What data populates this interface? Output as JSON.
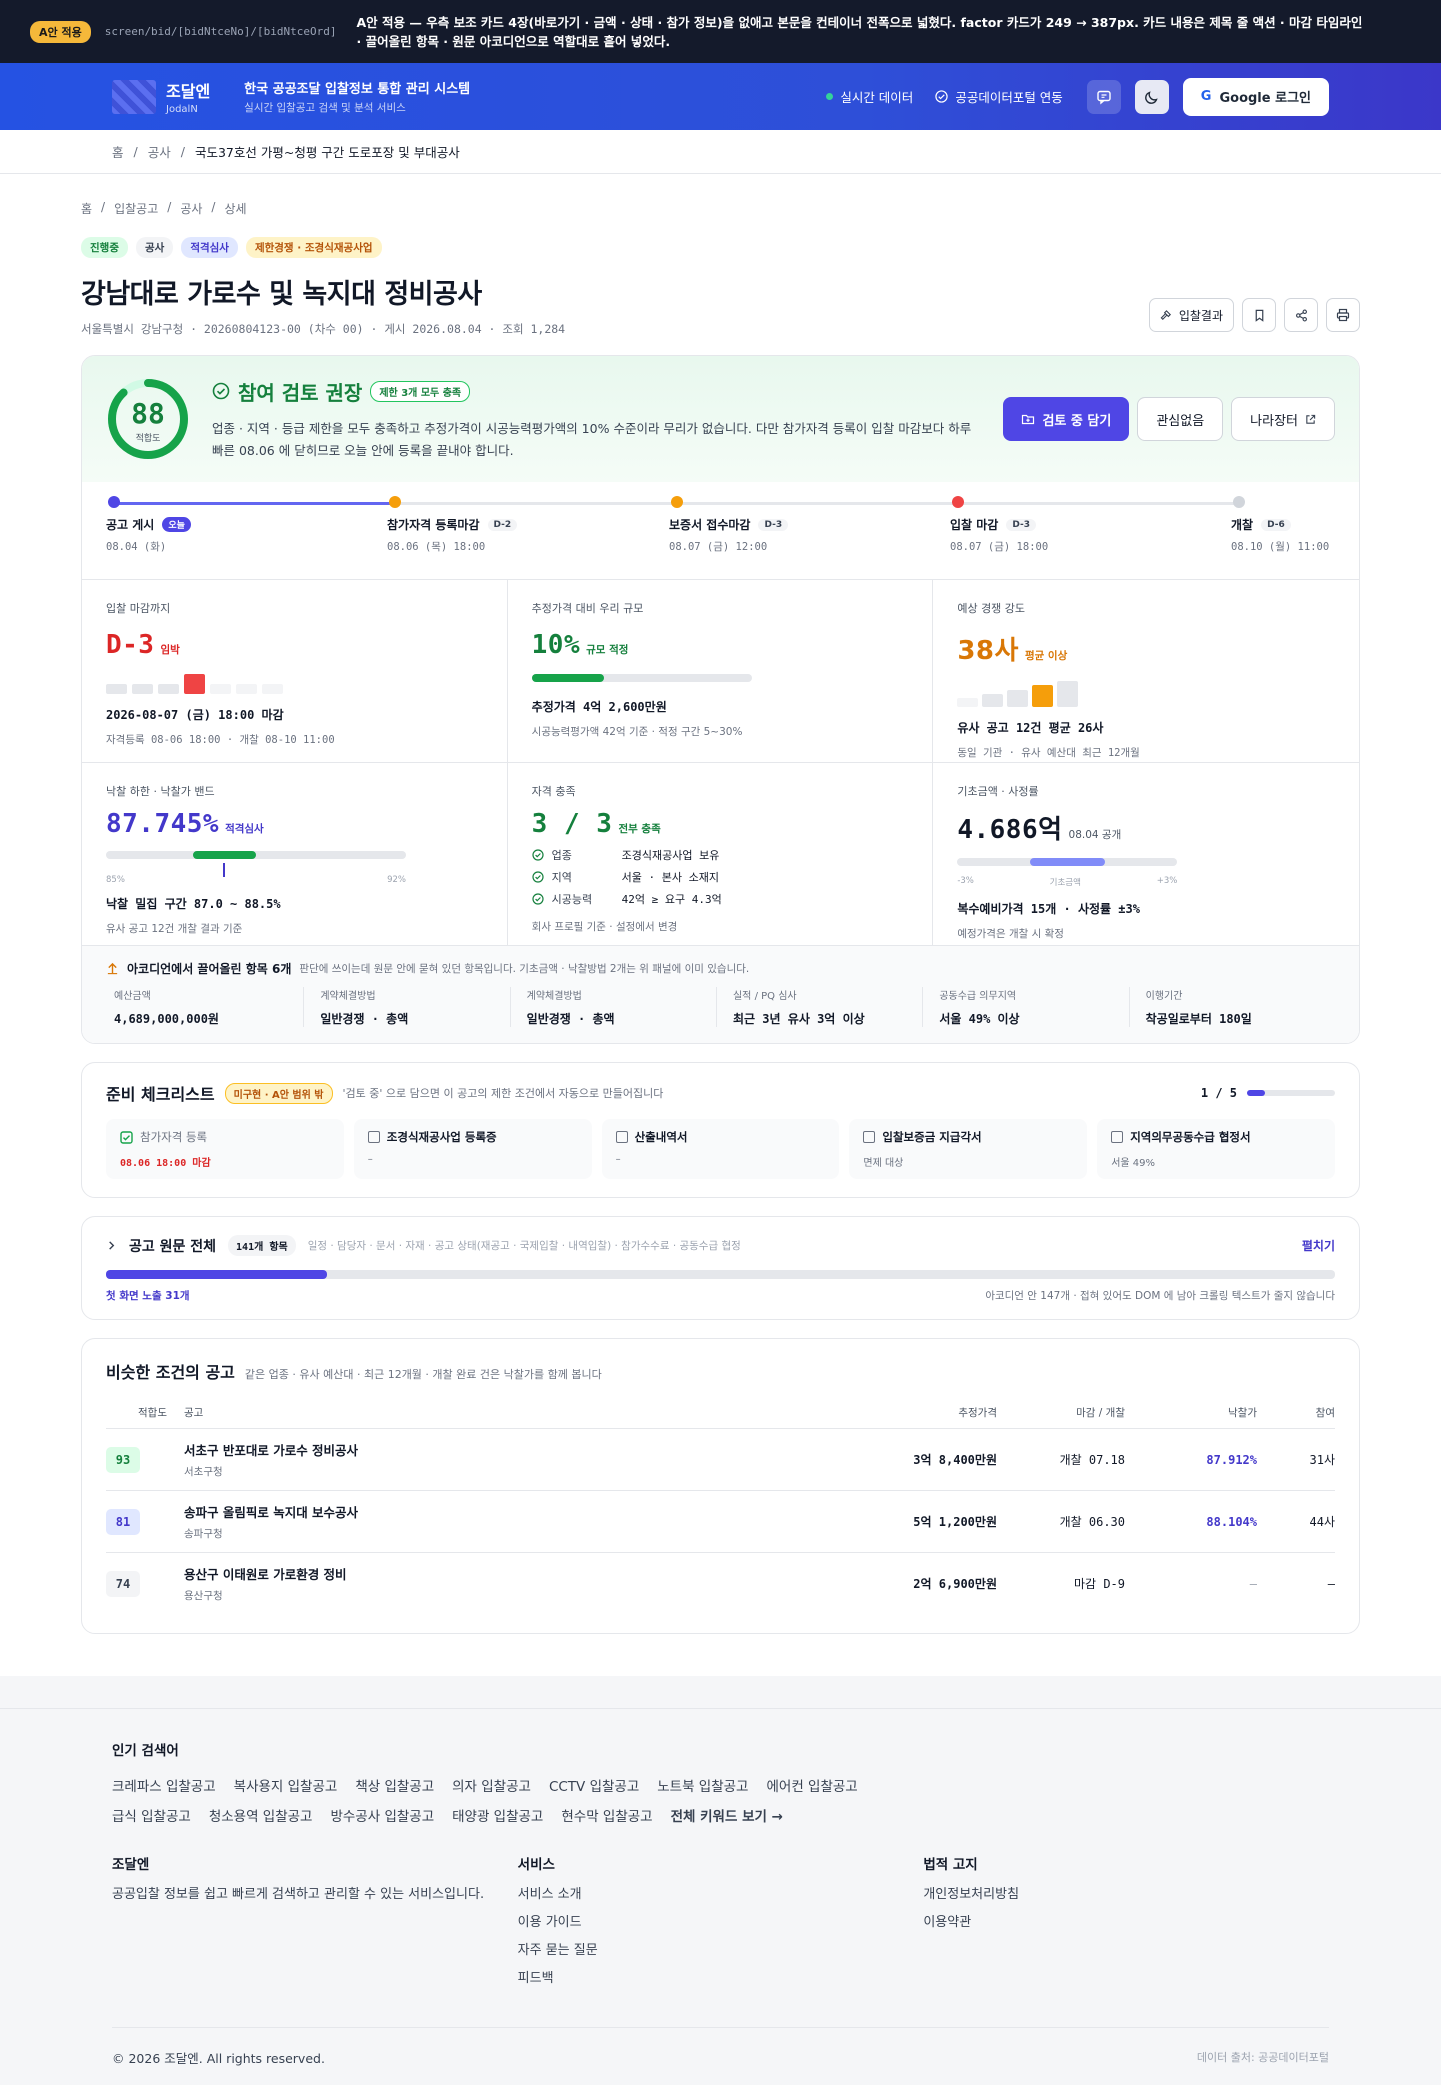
{
  "banner": {
    "pill": "A안 적용",
    "route": "screen/bid/[bidNtceNo]/[bidNtceOrd]",
    "note": "A안 적용 — 우측 보조 카드 4장(바로가기 · 금액 · 상태 · 참가 정보)을 없애고 본문을 컨테이너 전폭으로 넓혔다. factor 카드가 249 → 387px. 카드 내용은 제목 줄 액션 · 마감 타임라인 · 끌어올린 항목 · 원문 아코디언으로 역할대로 흩어 넣었다."
  },
  "header": {
    "brand": "조달엔",
    "brand_en": "JodalN",
    "title": "한국 공공조달 입찰정보 통합 관리 시스템",
    "subtitle": "실시간 입찰공고 검색 및 분석 서비스",
    "live": "실시간 데이터",
    "connect": "공공데이터포털 연동",
    "google_g": "G",
    "login": "Google 로그인"
  },
  "topcrumb": [
    "홈",
    "공사",
    "국도37호선 가평~청평 구간 도로포장 및 부대공사"
  ],
  "crumb": [
    "홈",
    "입찰공고",
    "공사",
    "상세"
  ],
  "tags": [
    "진행중",
    "공사",
    "적격심사",
    "제한경쟁 · 조경식재공사업"
  ],
  "title": "강남대로 가로수 및 녹지대 정비공사",
  "meta": "서울특별시 강남구청 · 20260804123-00 (차수 00) · 게시 2026.08.04 · 조회 1,284",
  "actions": {
    "result": "입찰결과"
  },
  "hero": {
    "score": "88",
    "score_label": "적합도",
    "score_value": 88,
    "verdict": "참여 검토 권장",
    "badge": "제한 3개 모두 충족",
    "desc": "업종 · 지역 · 등급 제한을 모두 충족하고 추정가격이 시공능력평가액의 10% 수준이라 무리가 없습니다. 다만 참가자격 등록이 입찰 마감보다 하루 빠른 08.06 에 닫히므로 오늘 안에 등록을 끝내야 합니다.",
    "primary": "검토 중 담기",
    "ghost1": "관심없음",
    "ghost2": "나라장터"
  },
  "timeline": [
    {
      "name": "공고 게시",
      "badge": "오늘",
      "date": "08.04 (화)",
      "color": "#4f46e5"
    },
    {
      "name": "참가자격 등록마감",
      "badge": "D-2",
      "date": "08.06 (목) 18:00",
      "color": "#f59e0b"
    },
    {
      "name": "보증서 접수마감",
      "badge": "D-3",
      "date": "08.07 (금) 12:00",
      "color": "#f59e0b"
    },
    {
      "name": "입찰 마감",
      "badge": "D-3",
      "date": "08.07 (금) 18:00",
      "color": "#ef4444"
    },
    {
      "name": "개찰",
      "badge": "D-6",
      "date": "08.10 (월) 11:00",
      "color": "#d1d5db"
    }
  ],
  "metrics": {
    "deadline": {
      "label": "입찰 마감까지",
      "big": "D-3",
      "small": "임박",
      "line1": "2026-08-07 (금) 18:00 마감",
      "line2": "자격등록 08-06 18:00 · 개찰 08-10 11:00"
    },
    "scale": {
      "label": "추정가격 대비 우리 규모",
      "big": "10%",
      "small": "규모 적정",
      "fill": 0.33,
      "line1": "추정가격 4억 2,600만원",
      "line2": "시공능력평가액 42억 기준 · 적정 구간 5~30%"
    },
    "competition": {
      "label": "예상 경쟁 강도",
      "big": "38사",
      "small": "평균 이상",
      "line1": "유사 공고 12건 평균 26사",
      "line2": "동일 기관 · 유사 예산대 최근 12개월"
    },
    "rate": {
      "label": "낙찰 하한 · 낙찰가 밴드",
      "big": "87.745%",
      "small": "적격심사",
      "axis": [
        "85%",
        "92%"
      ],
      "band": [
        0.29,
        0.5
      ],
      "marker": 0.39,
      "line1": "낙찰 밀집 구간 87.0 ~ 88.5%",
      "line2": "유사 공고 12건 개찰 결과 기준"
    },
    "qual": {
      "label": "자격 충족",
      "big": "3 / 3",
      "small": "전부 충족",
      "rows": [
        [
          "업종",
          "조경식재공사업 보유"
        ],
        [
          "지역",
          "서울 · 본사 소재지"
        ],
        [
          "시공능력",
          "42억 ≥ 요구 4.3억"
        ]
      ],
      "line2": "회사 프로필 기준 · 설정에서 변경"
    },
    "base": {
      "label": "기초금액 · 사정률",
      "big": "4.686억",
      "small": "08.04 공개",
      "axis": [
        "-3%",
        "기초금액",
        "+3%"
      ],
      "band": [
        0.33,
        0.67
      ],
      "line1": "복수예비가격 15개 · 사정률 ±3%",
      "line2": "예정가격은 개찰 시 확정"
    }
  },
  "extra": {
    "title": "아코디언에서 끌어올린 항목 6개",
    "hint": "판단에 쓰이는데 원문 안에 묻혀 있던 항목입니다. 기초금액 · 낙찰방법 2개는 위 패널에 이미 있습니다.",
    "items": [
      {
        "k": "예산금액",
        "v": "4,689,000,000원"
      },
      {
        "k": "계약체결방법",
        "v": "일반경쟁 · 총액"
      },
      {
        "k": "계약체결방법",
        "v": "일반경쟁 · 총액"
      },
      {
        "k": "실적 / PQ 심사",
        "v": "최근 3년 유사 3억 이상"
      },
      {
        "k": "공동수급 의무지역",
        "v": "서울 49% 이상"
      },
      {
        "k": "이행기간",
        "v": "착공일로부터 180일"
      }
    ]
  },
  "checklist": {
    "title": "준비 체크리스트",
    "badge": "미구현 · A안 범위 밖",
    "hint": "'검토 중' 으로 담으면 이 공고의 제한 조건에서 자동으로 만들어집니다",
    "progress": "1 / 5",
    "items": [
      {
        "t": "참가자격 등록",
        "s": "08.06 18:00 마감",
        "done": true
      },
      {
        "t": "조경식재공사업 등록증",
        "s": "–",
        "done": false
      },
      {
        "t": "산출내역서",
        "s": "–",
        "done": false
      },
      {
        "t": "입찰보증금 지급각서",
        "s": "면제 대상",
        "done": false
      },
      {
        "t": "지역의무공동수급 협정서",
        "s": "서울 49%",
        "done": false
      }
    ]
  },
  "original": {
    "title": "공고 원문 전체",
    "badge": "141개 항목",
    "hint": "일정 · 담당자 · 문서 · 자재 · 공고 상태(재공고 · 국제입찰 · 내역입찰) · 참가수수료 · 공동수급 협정",
    "toggle": "펼치기",
    "exposed": "첫 화면 노출 31개",
    "note": "아코디언 안 147개 · 접혀 있어도 DOM 에 남아 크롤링 텍스트가 줄지 않습니다"
  },
  "similar": {
    "title": "비슷한 조건의 공고",
    "hint": "같은 업종 · 유사 예산대 · 최근 12개월 · 개찰 완료 건은 낙찰가를 함께 봅니다",
    "cols": [
      "적합도",
      "공고",
      "추정가격",
      "마감 / 개찰",
      "낙찰가",
      "참여"
    ],
    "rows": [
      {
        "score": "93",
        "cls": "g",
        "name": "서초구 반포대로 가로수 정비공사",
        "agency": "서초구청",
        "price": "3억 8,400만원",
        "date": "개찰 07.18",
        "rate": "87.912%",
        "n": "31사"
      },
      {
        "score": "81",
        "cls": "b",
        "name": "송파구 올림픽로 녹지대 보수공사",
        "agency": "송파구청",
        "price": "5억 1,200만원",
        "date": "개찰 06.30",
        "rate": "88.104%",
        "n": "44사"
      },
      {
        "score": "74",
        "cls": "n",
        "name": "용산구 이태원로 가로환경 정비",
        "agency": "용산구청",
        "price": "2억 6,900만원",
        "date": "마감 D-9",
        "rate": "–",
        "n": "–"
      }
    ]
  },
  "footer": {
    "popular": "인기 검색어",
    "keywords": [
      "크레파스 입찰공고",
      "복사용지 입찰공고",
      "책상 입찰공고",
      "의자 입찰공고",
      "CCTV 입찰공고",
      "노트북 입찰공고",
      "에어컨 입찰공고",
      "급식 입찰공고",
      "청소용역 입찰공고",
      "방수공사 입찰공고",
      "태양광 입찰공고",
      "현수막 입찰공고",
      "전체 키워드 보기 →"
    ],
    "col1_title": "조달엔",
    "col1_text": "공공입찰 정보를 쉽고 빠르게 검색하고 관리할 수 있는 서비스입니다.",
    "col2_title": "서비스",
    "col2_items": [
      "서비스 소개",
      "이용 가이드",
      "자주 묻는 질문",
      "피드백"
    ],
    "col3_title": "법적 고지",
    "col3_items": [
      "개인정보처리방침",
      "이용약관"
    ],
    "copyright": "© 2026 조달엔. All rights reserved.",
    "source": "데이터 출처: 공공데이터포털"
  }
}
